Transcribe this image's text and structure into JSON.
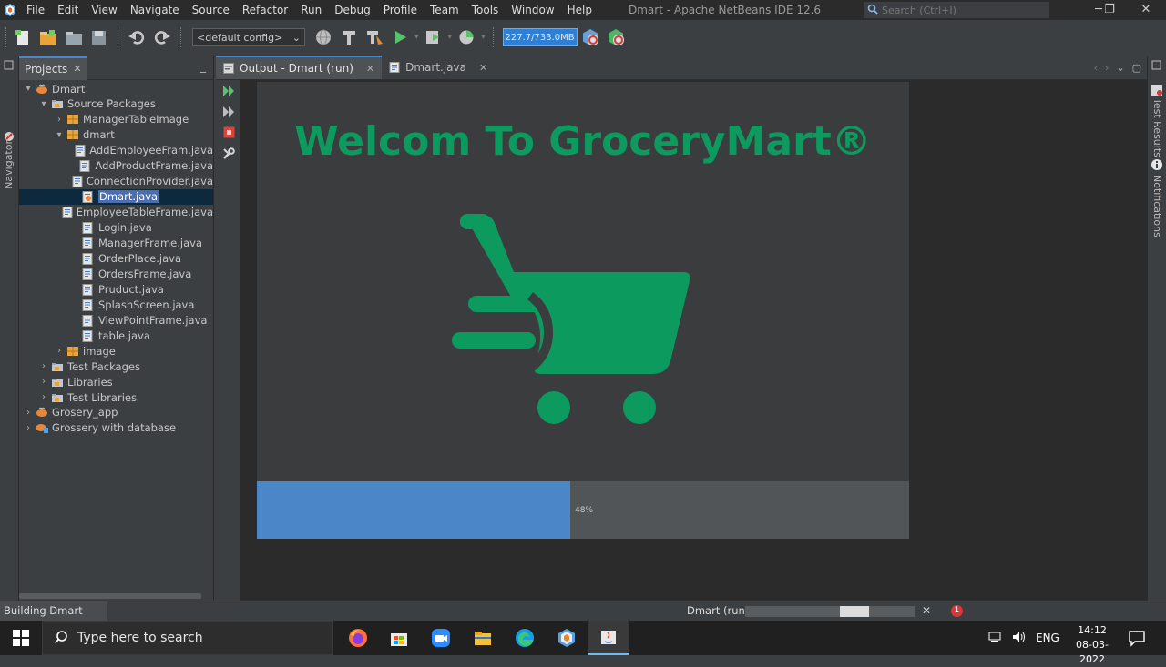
{
  "window": {
    "title": "Dmart - Apache NetBeans IDE 12.6",
    "search_placeholder": "Search (Ctrl+I)"
  },
  "menu": [
    "File",
    "Edit",
    "View",
    "Navigate",
    "Source",
    "Refactor",
    "Run",
    "Debug",
    "Profile",
    "Team",
    "Tools",
    "Window",
    "Help"
  ],
  "toolbar": {
    "config": "<default config>",
    "memory": "227.7/733.0MB"
  },
  "left_strip": {
    "navigator_label": "Navigator"
  },
  "projects": {
    "tab_label": "Projects",
    "tree": [
      {
        "label": "Dmart",
        "depth": 0,
        "arrow": "▾",
        "icon": "project"
      },
      {
        "label": "Source Packages",
        "depth": 1,
        "arrow": "▾",
        "icon": "folder"
      },
      {
        "label": "ManagerTableImage",
        "depth": 2,
        "arrow": "›",
        "icon": "package"
      },
      {
        "label": "dmart",
        "depth": 2,
        "arrow": "▾",
        "icon": "package"
      },
      {
        "label": "AddEmployeeFram.java",
        "depth": 3,
        "arrow": "",
        "icon": "java"
      },
      {
        "label": "AddProductFrame.java",
        "depth": 3,
        "arrow": "",
        "icon": "java"
      },
      {
        "label": "ConnectionProvider.java",
        "depth": 3,
        "arrow": "",
        "icon": "java"
      },
      {
        "label": "Dmart.java",
        "depth": 3,
        "arrow": "",
        "icon": "java-main",
        "selected": true
      },
      {
        "label": "EmployeeTableFrame.java",
        "depth": 3,
        "arrow": "",
        "icon": "java"
      },
      {
        "label": "Login.java",
        "depth": 3,
        "arrow": "",
        "icon": "java"
      },
      {
        "label": "ManagerFrame.java",
        "depth": 3,
        "arrow": "",
        "icon": "java"
      },
      {
        "label": "OrderPlace.java",
        "depth": 3,
        "arrow": "",
        "icon": "java"
      },
      {
        "label": "OrdersFrame.java",
        "depth": 3,
        "arrow": "",
        "icon": "java"
      },
      {
        "label": "Pruduct.java",
        "depth": 3,
        "arrow": "",
        "icon": "java"
      },
      {
        "label": "SplashScreen.java",
        "depth": 3,
        "arrow": "",
        "icon": "java"
      },
      {
        "label": "ViewPointFrame.java",
        "depth": 3,
        "arrow": "",
        "icon": "java"
      },
      {
        "label": "table.java",
        "depth": 3,
        "arrow": "",
        "icon": "java"
      },
      {
        "label": "image",
        "depth": 2,
        "arrow": "›",
        "icon": "package"
      },
      {
        "label": "Test Packages",
        "depth": 1,
        "arrow": "›",
        "icon": "folder"
      },
      {
        "label": "Libraries",
        "depth": 1,
        "arrow": "›",
        "icon": "folder"
      },
      {
        "label": "Test Libraries",
        "depth": 1,
        "arrow": "›",
        "icon": "folder"
      },
      {
        "label": "Grosery_app",
        "depth": 0,
        "arrow": "›",
        "icon": "project"
      },
      {
        "label": "Grossery with database",
        "depth": 0,
        "arrow": "›",
        "icon": "project-db"
      }
    ]
  },
  "editor_tabs": [
    {
      "label": "Output - Dmart (run)",
      "active": true
    },
    {
      "label": "Dmart.java",
      "active": false
    }
  ],
  "right_strip": {
    "test_results": "Test Results",
    "notifications": "Notifications"
  },
  "splash": {
    "title": "Welcom To GroceryMart®",
    "progress_percent": 48,
    "progress_text": "48%",
    "brand_color": "#0c9a5f"
  },
  "status": {
    "building": "Building Dmart (run)...",
    "run_label": "Dmart (run)",
    "notification_count": "1"
  },
  "taskbar": {
    "search_placeholder": "Type here to search",
    "language": "ENG",
    "time": "14:12",
    "date": "08-03-2022"
  }
}
